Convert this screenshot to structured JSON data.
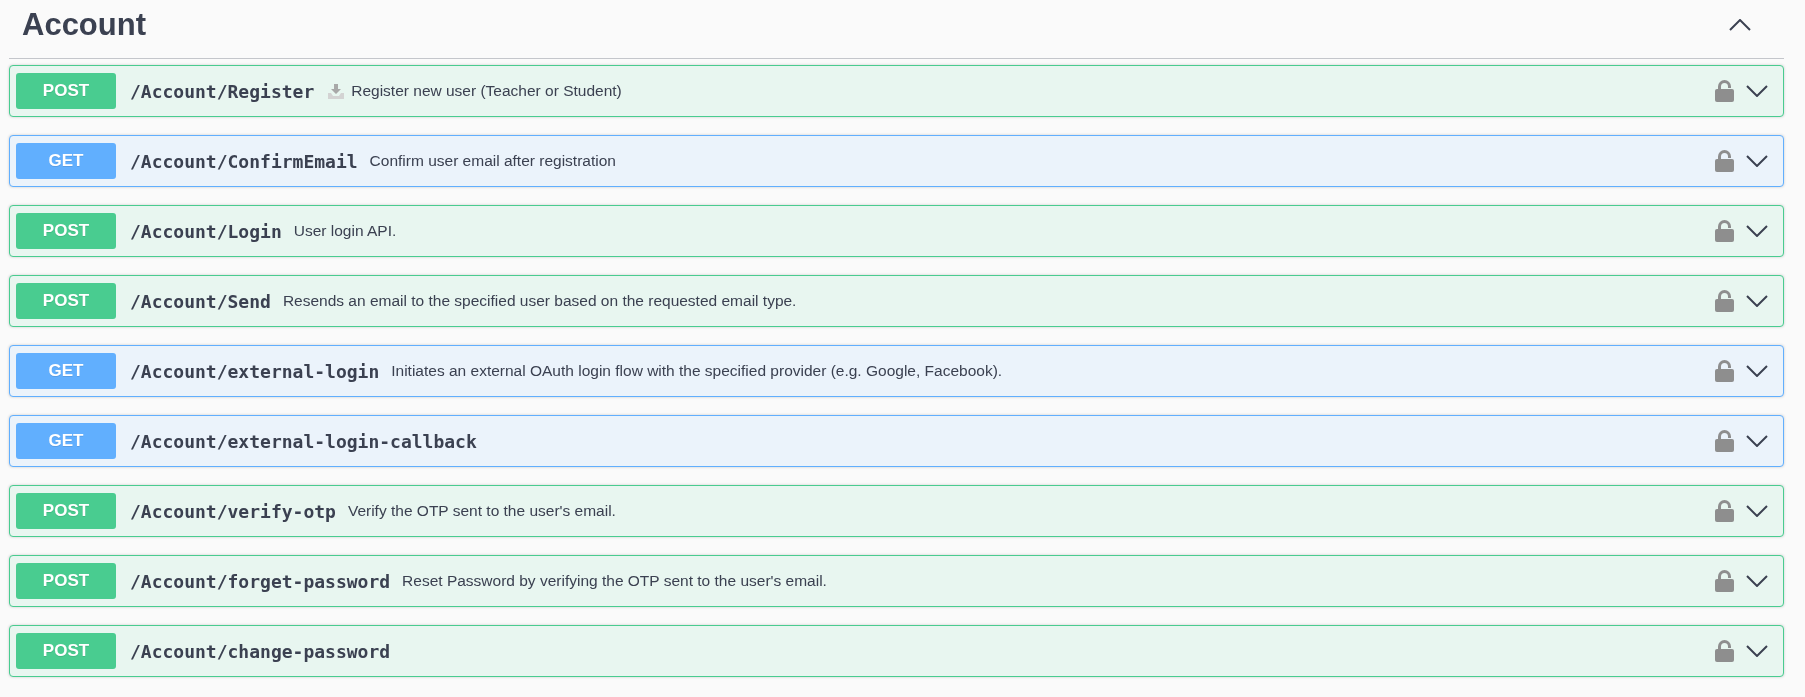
{
  "section": {
    "title": "Account",
    "expanded": true
  },
  "operations": [
    {
      "kind": "post",
      "method": "POST",
      "path": "/Account/Register",
      "icon": true,
      "description": "Register new user (Teacher or Student)",
      "locked": false,
      "expanded": false
    },
    {
      "kind": "get",
      "method": "GET",
      "path": "/Account/ConfirmEmail",
      "icon": false,
      "description": "Confirm user email after registration",
      "locked": false,
      "expanded": false
    },
    {
      "kind": "post",
      "method": "POST",
      "path": "/Account/Login",
      "icon": false,
      "description": "User login API.",
      "locked": false,
      "expanded": false
    },
    {
      "kind": "post",
      "method": "POST",
      "path": "/Account/Send",
      "icon": false,
      "description": "Resends an email to the specified user based on the requested email type.",
      "locked": false,
      "expanded": false
    },
    {
      "kind": "get",
      "method": "GET",
      "path": "/Account/external-login",
      "icon": false,
      "description": "Initiates an external OAuth login flow with the specified provider (e.g. Google, Facebook).",
      "locked": false,
      "expanded": false
    },
    {
      "kind": "get",
      "method": "GET",
      "path": "/Account/external-login-callback",
      "icon": false,
      "locked": false,
      "expanded": false
    },
    {
      "kind": "post",
      "method": "POST",
      "path": "/Account/verify-otp",
      "icon": false,
      "description": "Verify the OTP sent to the user's email.",
      "locked": false,
      "expanded": false
    },
    {
      "kind": "post",
      "method": "POST",
      "path": "/Account/forget-password",
      "icon": false,
      "description": "Reset Password by verifying the OTP sent to the user's email.",
      "locked": false,
      "expanded": false
    },
    {
      "kind": "post",
      "method": "POST",
      "path": "/Account/change-password",
      "icon": false,
      "locked": false,
      "expanded": false
    }
  ]
}
